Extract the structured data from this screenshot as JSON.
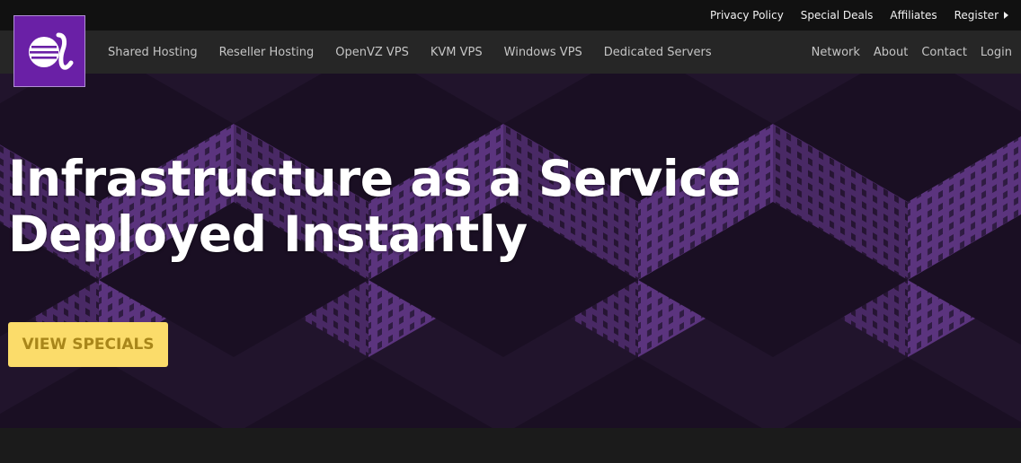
{
  "top_links": {
    "privacy": "Privacy Policy",
    "deals": "Special Deals",
    "affiliates": "Affiliates",
    "register": "Register"
  },
  "nav": {
    "left": [
      "Shared Hosting",
      "Reseller Hosting",
      "OpenVZ VPS",
      "KVM VPS",
      "Windows VPS",
      "Dedicated Servers"
    ],
    "right": [
      "Network",
      "About",
      "Contact",
      "Login"
    ]
  },
  "logo": {
    "icon": "alpha-logo-icon",
    "color": "#6a20a6"
  },
  "hero": {
    "title_line1": "Infrastructure as a Service",
    "title_line2": "Deployed Instantly",
    "cta_label": "VIEW SPECIALS",
    "background_color": "#23152f",
    "accent_color": "#fbdc6a"
  }
}
